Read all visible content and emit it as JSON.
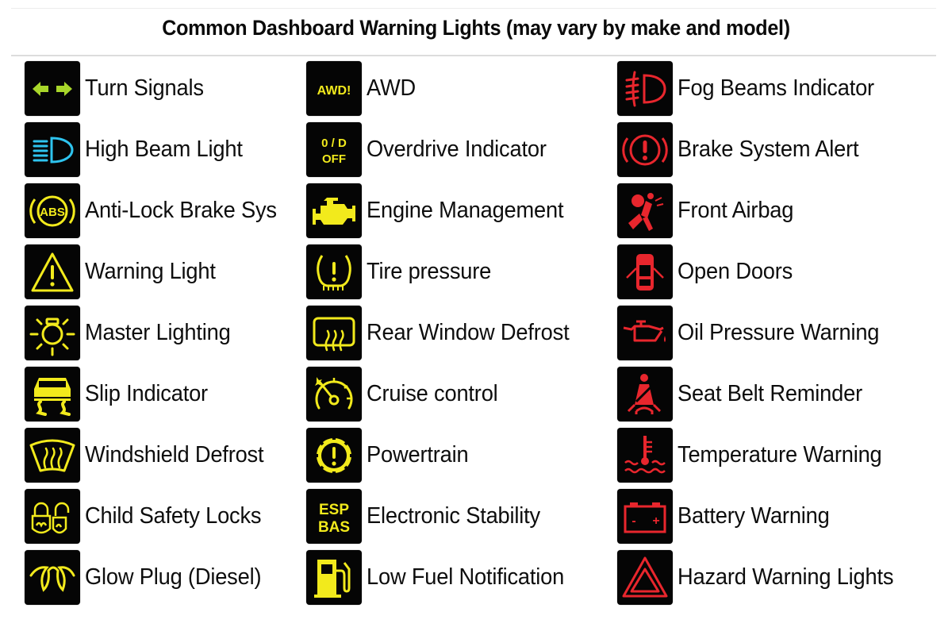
{
  "title": "Common Dashboard Warning Lights (may vary by make and model)",
  "colors": {
    "green": "#a8d62a",
    "blue": "#2ec4ef",
    "yellow": "#f2ea1c",
    "red": "#e8262d",
    "icon_bg": "#050505"
  },
  "columns": [
    {
      "items": [
        {
          "label": "Turn Signals",
          "icon": "turn-signals-icon",
          "color": "green"
        },
        {
          "label": "High Beam Light",
          "icon": "high-beam-icon",
          "color": "blue"
        },
        {
          "label": "Anti-Lock Brake Sys",
          "icon": "abs-icon",
          "color": "yellow",
          "icon_text": "ABS"
        },
        {
          "label": "Warning Light",
          "icon": "warning-triangle-icon",
          "color": "yellow"
        },
        {
          "label": "Master Lighting",
          "icon": "master-lighting-icon",
          "color": "yellow"
        },
        {
          "label": "Slip Indicator",
          "icon": "slip-indicator-icon",
          "color": "yellow"
        },
        {
          "label": "Windshield Defrost",
          "icon": "windshield-defrost-icon",
          "color": "yellow"
        },
        {
          "label": "Child Safety Locks",
          "icon": "child-safety-locks-icon",
          "color": "yellow"
        },
        {
          "label": "Glow Plug (Diesel)",
          "icon": "glow-plug-icon",
          "color": "yellow"
        }
      ]
    },
    {
      "items": [
        {
          "label": "AWD",
          "icon": "awd-icon",
          "color": "yellow",
          "icon_text": "AWD!"
        },
        {
          "label": "Overdrive Indicator",
          "icon": "overdrive-off-icon",
          "color": "yellow",
          "icon_text": "0 / D",
          "icon_text2": "OFF"
        },
        {
          "label": "Engine Management",
          "icon": "engine-icon",
          "color": "yellow"
        },
        {
          "label": "Tire pressure",
          "icon": "tire-pressure-icon",
          "color": "yellow"
        },
        {
          "label": "Rear Window Defrost",
          "icon": "rear-window-defrost-icon",
          "color": "yellow"
        },
        {
          "label": "Cruise control",
          "icon": "cruise-control-icon",
          "color": "yellow"
        },
        {
          "label": "Powertrain",
          "icon": "powertrain-icon",
          "color": "yellow"
        },
        {
          "label": "Electronic Stability",
          "icon": "esp-bas-icon",
          "color": "yellow",
          "icon_text": "ESP",
          "icon_text2": "BAS"
        },
        {
          "label": "Low Fuel Notification",
          "icon": "low-fuel-icon",
          "color": "yellow"
        }
      ]
    },
    {
      "items": [
        {
          "label": "Fog Beams Indicator",
          "icon": "fog-beams-icon",
          "color": "red"
        },
        {
          "label": "Brake System Alert",
          "icon": "brake-system-icon",
          "color": "red"
        },
        {
          "label": "Front Airbag",
          "icon": "airbag-icon",
          "color": "red"
        },
        {
          "label": "Open Doors",
          "icon": "open-doors-icon",
          "color": "red"
        },
        {
          "label": "Oil Pressure Warning",
          "icon": "oil-pressure-icon",
          "color": "red"
        },
        {
          "label": "Seat Belt Reminder",
          "icon": "seat-belt-icon",
          "color": "red"
        },
        {
          "label": "Temperature Warning",
          "icon": "temperature-icon",
          "color": "red"
        },
        {
          "label": "Battery Warning",
          "icon": "battery-icon",
          "color": "red",
          "icon_text": "-",
          "icon_text2": "+"
        },
        {
          "label": "Hazard Warning Lights",
          "icon": "hazard-icon",
          "color": "red"
        }
      ]
    }
  ]
}
